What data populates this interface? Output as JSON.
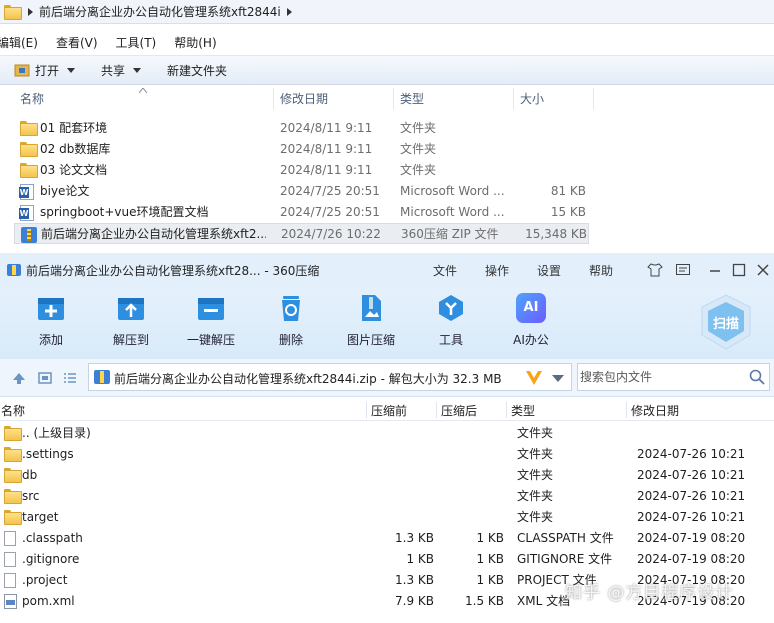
{
  "explorer": {
    "breadcrumb": "前后端分离企业办公自动化管理系统xft2844i",
    "menu": [
      "编辑(E)",
      "查看(V)",
      "工具(T)",
      "帮助(H)"
    ],
    "commands": {
      "open": "打开",
      "share": "共享",
      "new_folder": "新建文件夹"
    },
    "columns": {
      "name": "名称",
      "modified": "修改日期",
      "type": "类型",
      "size": "大小"
    },
    "files": [
      {
        "icon": "folder-icon",
        "name": "01 配套环境",
        "modified": "2024/8/11 9:11",
        "type": "文件夹",
        "size": ""
      },
      {
        "icon": "folder-icon",
        "name": "02 db数据库",
        "modified": "2024/8/11 9:11",
        "type": "文件夹",
        "size": ""
      },
      {
        "icon": "folder-icon",
        "name": "03 论文文档",
        "modified": "2024/8/11 9:11",
        "type": "文件夹",
        "size": ""
      },
      {
        "icon": "word-doc-icon",
        "name": "biye论文",
        "modified": "2024/7/25 20:51",
        "type": "Microsoft Word ...",
        "size": "81 KB"
      },
      {
        "icon": "word-doc-icon",
        "name": "springboot+vue环境配置文档",
        "modified": "2024/7/25 20:51",
        "type": "Microsoft Word ...",
        "size": "15 KB"
      },
      {
        "icon": "zip-archive-icon",
        "name": "前后端分离企业办公自动化管理系统xft2...",
        "modified": "2024/7/26 10:22",
        "type": "360压缩 ZIP 文件",
        "size": "15,348 KB",
        "selected": true
      }
    ]
  },
  "zip": {
    "title": "前后端分离企业办公自动化管理系统xft28... - 360压缩",
    "menu": {
      "file": "文件",
      "ops": "操作",
      "settings": "设置",
      "help": "帮助"
    },
    "tools": {
      "add": "添加",
      "extract_to": "解压到",
      "one_click": "一键解压",
      "delete": "删除",
      "image": "图片压缩",
      "tools": "工具",
      "ai": "AI办公",
      "ai_badge": "AI"
    },
    "scan": "扫描",
    "path": "前后端分离企业办公自动化管理系统xft2844i.zip - 解包大小为 32.3 MB",
    "search_placeholder": "搜索包内文件",
    "columns": {
      "name": "名称",
      "before": "压缩前",
      "after": "压缩后",
      "type": "类型",
      "modified": "修改日期"
    },
    "files": [
      {
        "icon": "folder-icon",
        "name": ".. (上级目录)",
        "before": "",
        "after": "",
        "type": "文件夹",
        "modified": ""
      },
      {
        "icon": "folder-icon",
        "name": ".settings",
        "before": "",
        "after": "",
        "type": "文件夹",
        "modified": "2024-07-26 10:21"
      },
      {
        "icon": "folder-icon",
        "name": "db",
        "before": "",
        "after": "",
        "type": "文件夹",
        "modified": "2024-07-26 10:21"
      },
      {
        "icon": "folder-icon",
        "name": "src",
        "before": "",
        "after": "",
        "type": "文件夹",
        "modified": "2024-07-26 10:21"
      },
      {
        "icon": "folder-icon",
        "name": "target",
        "before": "",
        "after": "",
        "type": "文件夹",
        "modified": "2024-07-26 10:21"
      },
      {
        "icon": "file-icon",
        "name": ".classpath",
        "before": "1.3 KB",
        "after": "1 KB",
        "type": "CLASSPATH 文件",
        "modified": "2024-07-19 08:20"
      },
      {
        "icon": "file-icon",
        "name": ".gitignore",
        "before": "1 KB",
        "after": "1 KB",
        "type": "GITIGNORE 文件",
        "modified": "2024-07-19 08:20"
      },
      {
        "icon": "file-icon",
        "name": ".project",
        "before": "1.3 KB",
        "after": "1 KB",
        "type": "PROJECT 文件",
        "modified": "2024-07-19 08:20"
      },
      {
        "icon": "xml-file-icon",
        "name": "pom.xml",
        "before": "7.9 KB",
        "after": "1.5 KB",
        "type": "XML 文档",
        "modified": "2024-07-19 08:20"
      }
    ]
  },
  "watermark": "知乎 @方目程序设计",
  "colors": {
    "zip_accent": "#2e8ee0",
    "selection": "#eaedf1",
    "folder": "#f2c44d"
  }
}
